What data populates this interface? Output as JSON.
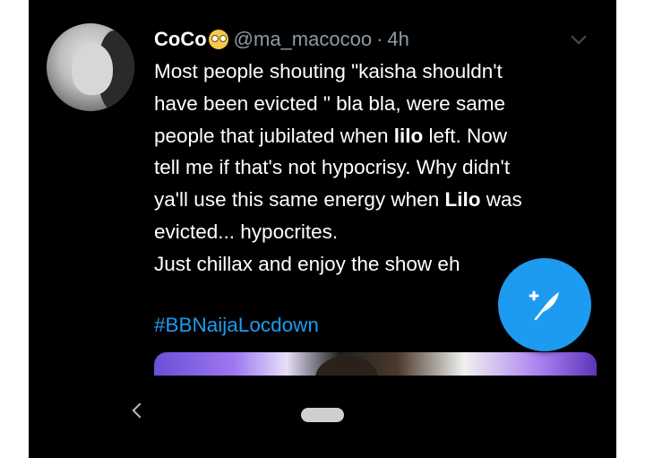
{
  "tweet": {
    "display_name": "CoCo",
    "emoji": "face-with-rolling-eyes",
    "handle": "@ma_macocoo",
    "separator": "·",
    "timestamp": "4h",
    "lines": [
      [
        {
          "t": "Most people shouting \"kaisha shouldn't"
        }
      ],
      [
        {
          "t": "have been evicted \" bla bla, were same"
        }
      ],
      [
        {
          "t": "people that jubilated when "
        },
        {
          "t": "lilo",
          "b": true
        },
        {
          "t": " left. Now"
        }
      ],
      [
        {
          "t": "tell me if that's not hypocrisy. Why didn't"
        }
      ],
      [
        {
          "t": "ya'll use this same energy when "
        },
        {
          "t": "Lilo",
          "b": true
        },
        {
          "t": " was"
        }
      ],
      [
        {
          "t": "evicted... hypocrites."
        }
      ],
      [
        {
          "t": "Just chillax and enjoy the show eh"
        }
      ]
    ],
    "hashtag": "#BBNaijaLocdown"
  },
  "icons": {
    "compose": "feather-plus-icon",
    "back": "back-chevron-icon",
    "home": "home-pill-icon",
    "caret": "chevron-down-icon"
  },
  "colors": {
    "background": "#000000",
    "accent": "#1d9bf0",
    "muted": "#8f9aa3"
  }
}
